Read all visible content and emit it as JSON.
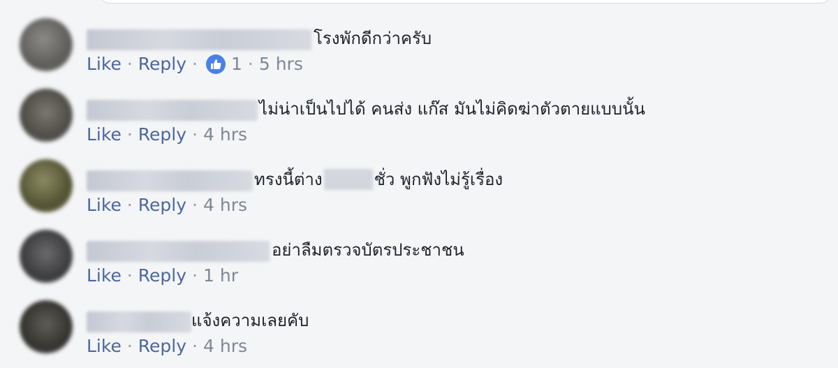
{
  "actions": {
    "like": "Like",
    "reply": "Reply",
    "separator": "·"
  },
  "comments": [
    {
      "text": "โรงพักดีกว่าครับ",
      "reaction_count": "1",
      "time": "5 hrs"
    },
    {
      "text": "ไม่น่าเป็นไปได้ คนส่ง แก๊ส มันไม่คิดฆ่าตัวตายแบบนั้น",
      "time": "4 hrs"
    },
    {
      "text_before": "ทรงนี้ต่าง",
      "text_after": "ชั่ว พูกฟังไม่รู้เรื่อง",
      "time": "4 hrs"
    },
    {
      "text": "อย่าลืมตรวจบัตรประชาชน",
      "time": "1 hr"
    },
    {
      "text": "แจ้งความเลยคับ",
      "time": "4 hrs"
    }
  ],
  "colors": {
    "link": "#4b67a1",
    "meta": "#7f8695",
    "like_blue": "#4a80e8"
  },
  "icons": {
    "reaction": "thumbs-up-icon"
  }
}
